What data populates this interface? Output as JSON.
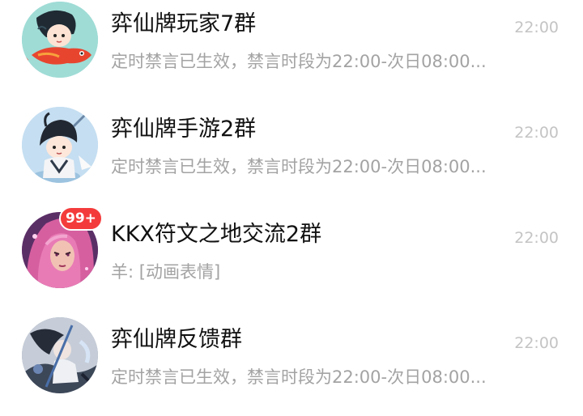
{
  "chats": [
    {
      "title": "弈仙牌玩家7群",
      "time": "22:00",
      "preview": "定时禁言已生效，禁言时段为22:00-次日08:00...",
      "avatar_icon": "anime-character-with-red-fish-avatar",
      "avatar_bg": "#8fd3d0"
    },
    {
      "title": "弈仙牌手游2群",
      "time": "22:00",
      "preview": "定时禁言已生效，禁言时段为22:00-次日08:00...",
      "avatar_icon": "anime-swordsman-chibi-avatar",
      "avatar_bg": "#b9d8f0"
    },
    {
      "title": "KKX符文之地交流2群",
      "time": "22:00",
      "preview": "羊: [动画表情]",
      "badge": "99+",
      "avatar_icon": "pink-haired-champion-avatar",
      "avatar_bg": "#7a3d7f"
    },
    {
      "title": "弈仙牌反馈群",
      "time": "22:00",
      "preview": "定时禁言已生效，禁言时段为22:00-次日08:00...",
      "avatar_icon": "ink-style-warrior-avatar",
      "avatar_bg": "#9aa4b4"
    }
  ],
  "colors": {
    "title": "#111111",
    "time": "#c4c4c4",
    "preview": "#a3a3a3",
    "badge": "#f43b3b"
  }
}
